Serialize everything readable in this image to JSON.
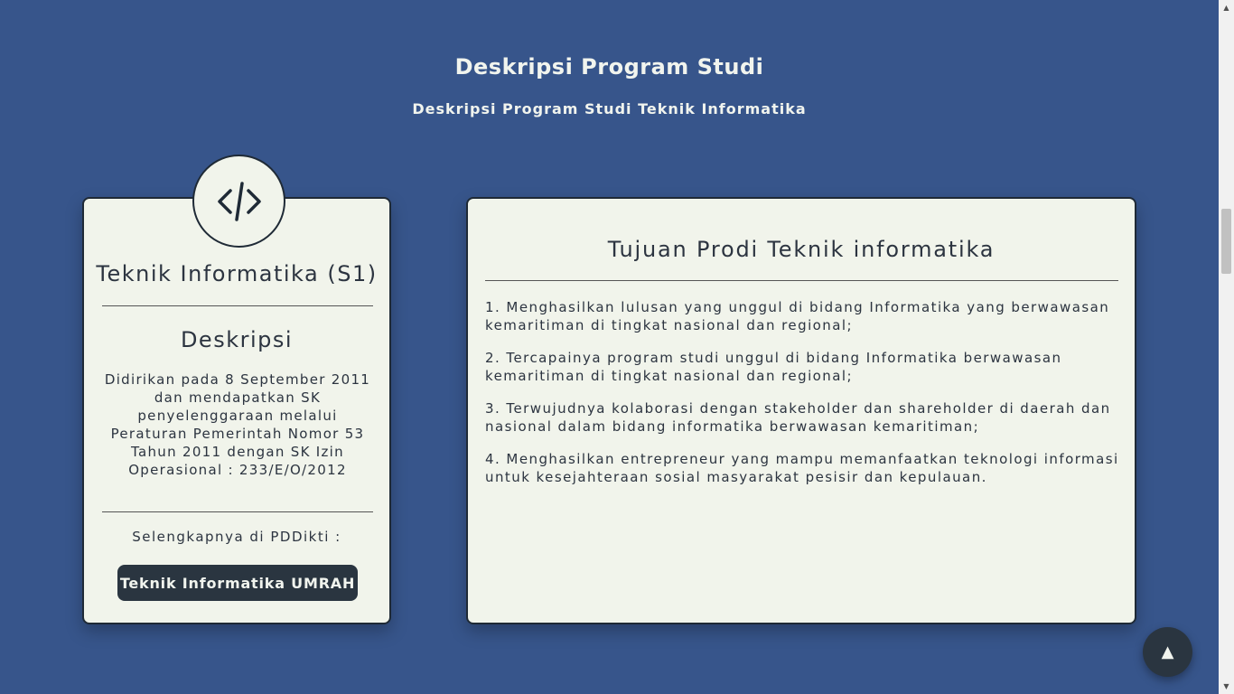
{
  "header": {
    "title": "Deskripsi Program Studi",
    "subtitle": "Deskripsi Program Studi Teknik Informatika"
  },
  "program_card": {
    "icon": "code-icon",
    "name": "Teknik Informatika (S1)",
    "description_title": "Deskripsi",
    "description_text": "Didirikan pada 8 September 2011 dan mendapatkan SK penyelenggaraan melalui Peraturan Pemerintah Nomor 53 Tahun 2011 dengan SK Izin Operasional : 233/E/O/2012",
    "more_label": "Selengkapnya di PDDikti :",
    "button_label": "Teknik Informatika UMRAH"
  },
  "goals_card": {
    "title": "Tujuan Prodi Teknik informatika",
    "items": [
      "1. Menghasilkan lulusan yang unggul di bidang Informatika yang berwawasan kemaritiman di tingkat nasional dan regional;",
      "2. Tercapainya program studi unggul di bidang Informatika berwawasan kemaritiman di tingkat nasional dan regional;",
      "3. Terwujudnya kolaborasi dengan stakeholder dan shareholder di daerah dan nasional dalam bidang informatika berwawasan kemaritiman;",
      "4. Menghasilkan entrepreneur yang mampu memanfaatkan teknologi informasi untuk kesejahteraan sosial masyarakat pesisir dan kepulauan."
    ]
  },
  "back_to_top": {
    "icon": "arrow-up-icon",
    "label": "▲"
  },
  "scrollbar": {
    "up_arrow": "▲",
    "down_arrow": "▼"
  },
  "colors": {
    "background": "#37558b",
    "card": "#f1f4eb",
    "button": "#2a3540",
    "text_light": "#f1f4ee"
  }
}
